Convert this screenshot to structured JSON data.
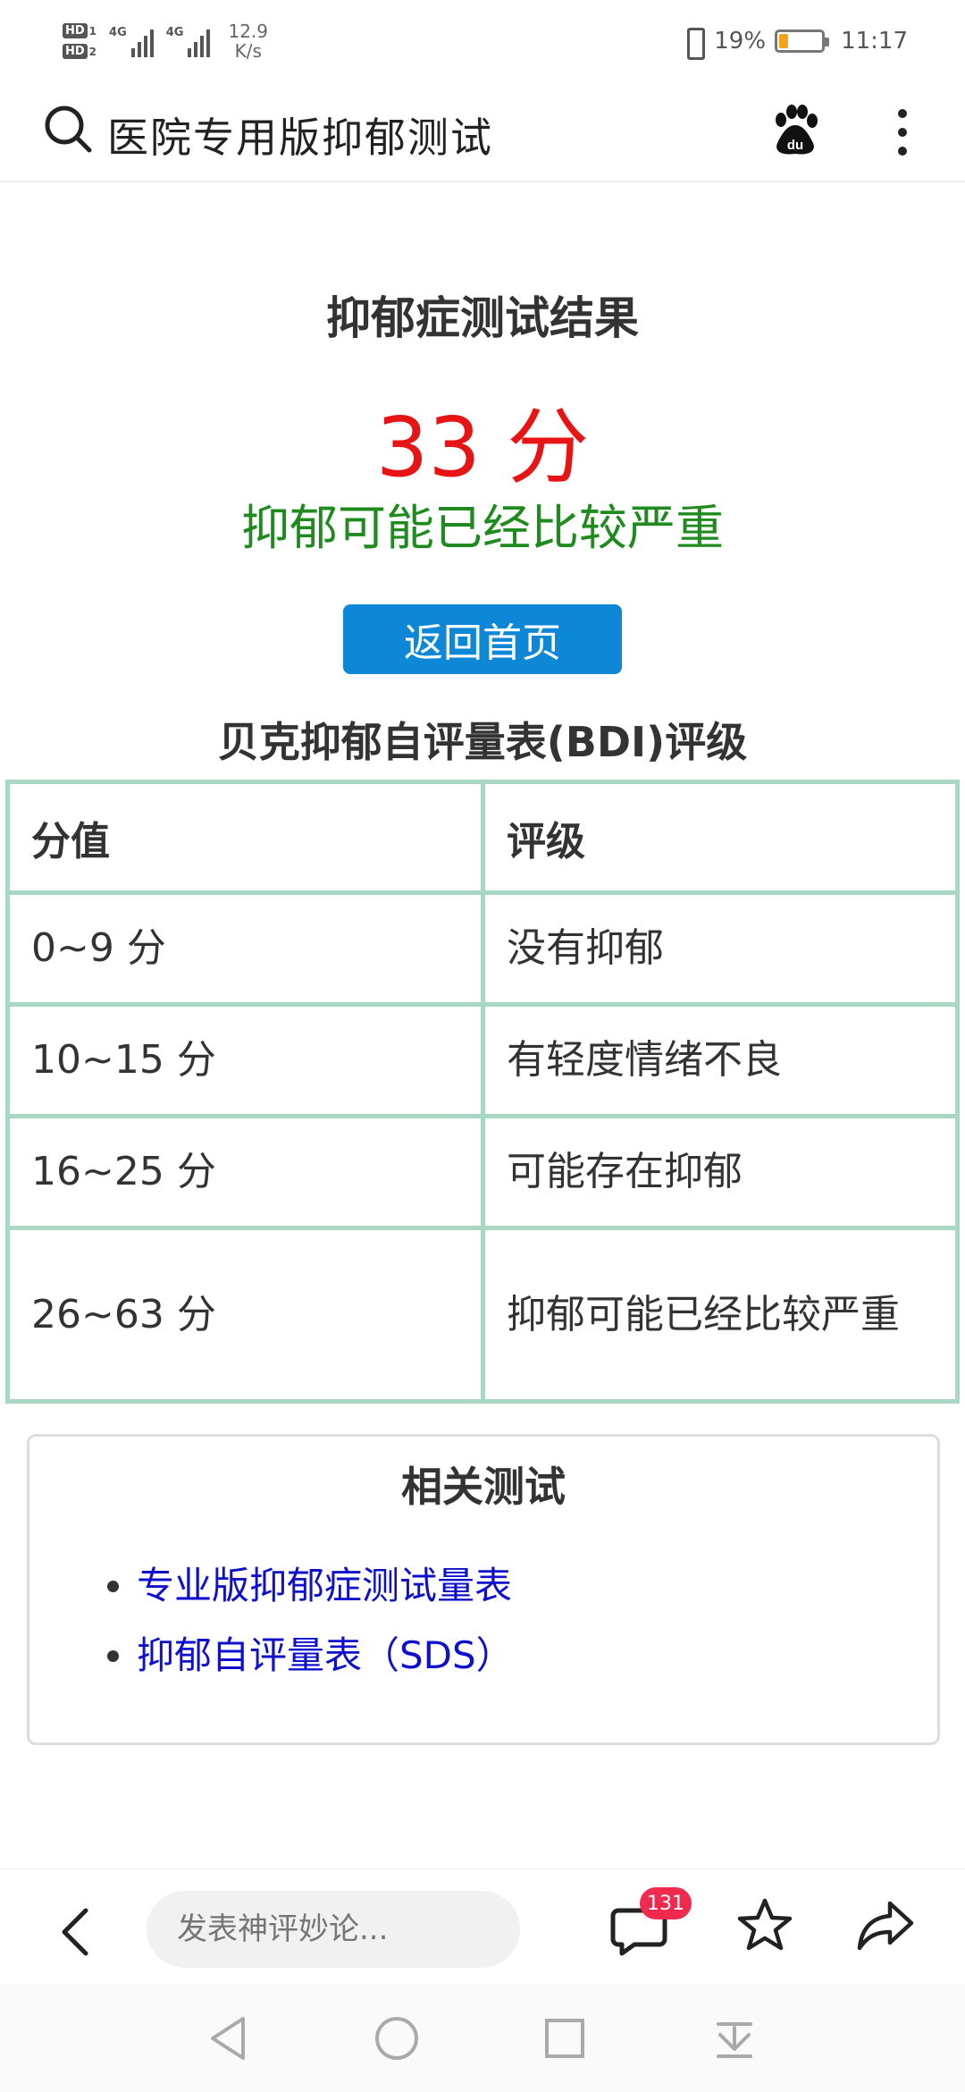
{
  "status_bar": {
    "hd1": "HD",
    "hd1_num": "1",
    "hd2": "HD",
    "hd2_num": "2",
    "net1": "4G",
    "net2": "4G",
    "speed_value": "12.9",
    "speed_unit": "K/s",
    "battery_text": "19%",
    "battery_level": 0.19,
    "time": "11:17"
  },
  "search_bar": {
    "query": "医院专用版抑郁测试",
    "icons": [
      "search-icon",
      "baidu-paw-icon",
      "more-vertical-icon"
    ]
  },
  "result": {
    "title": "抑郁症测试结果",
    "score": "33 分",
    "verdict": "抑郁可能已经比较严重",
    "home_button": "返回首页",
    "colors": {
      "score": "#e61414",
      "verdict": "#1f8b1f",
      "button": "#0d87d6"
    }
  },
  "bdi_table": {
    "title": "贝克抑郁自评量表(BDI)评级",
    "headers": [
      "分值",
      "评级"
    ],
    "rows": [
      {
        "score": "0~9 分",
        "rating": "没有抑郁"
      },
      {
        "score": "10~15 分",
        "rating": "有轻度情绪不良"
      },
      {
        "score": "16~25 分",
        "rating": "可能存在抑郁"
      },
      {
        "score": "26~63 分",
        "rating": "抑郁可能已经比较严重"
      }
    ],
    "border_color": "#a8d8c4"
  },
  "related": {
    "title": "相关测试",
    "links": [
      "专业版抑郁症测试量表",
      "抑郁自评量表（SDS）"
    ],
    "link_color": "#1010cc"
  },
  "toolbar": {
    "comment_placeholder": "发表神评妙论...",
    "badge_count": "131",
    "icons": [
      "back-icon",
      "comment-icon",
      "star-icon",
      "share-icon"
    ]
  },
  "nav_bar": {
    "icons": [
      "nav-back-icon",
      "nav-home-icon",
      "nav-recents-icon",
      "nav-collapse-icon"
    ]
  }
}
